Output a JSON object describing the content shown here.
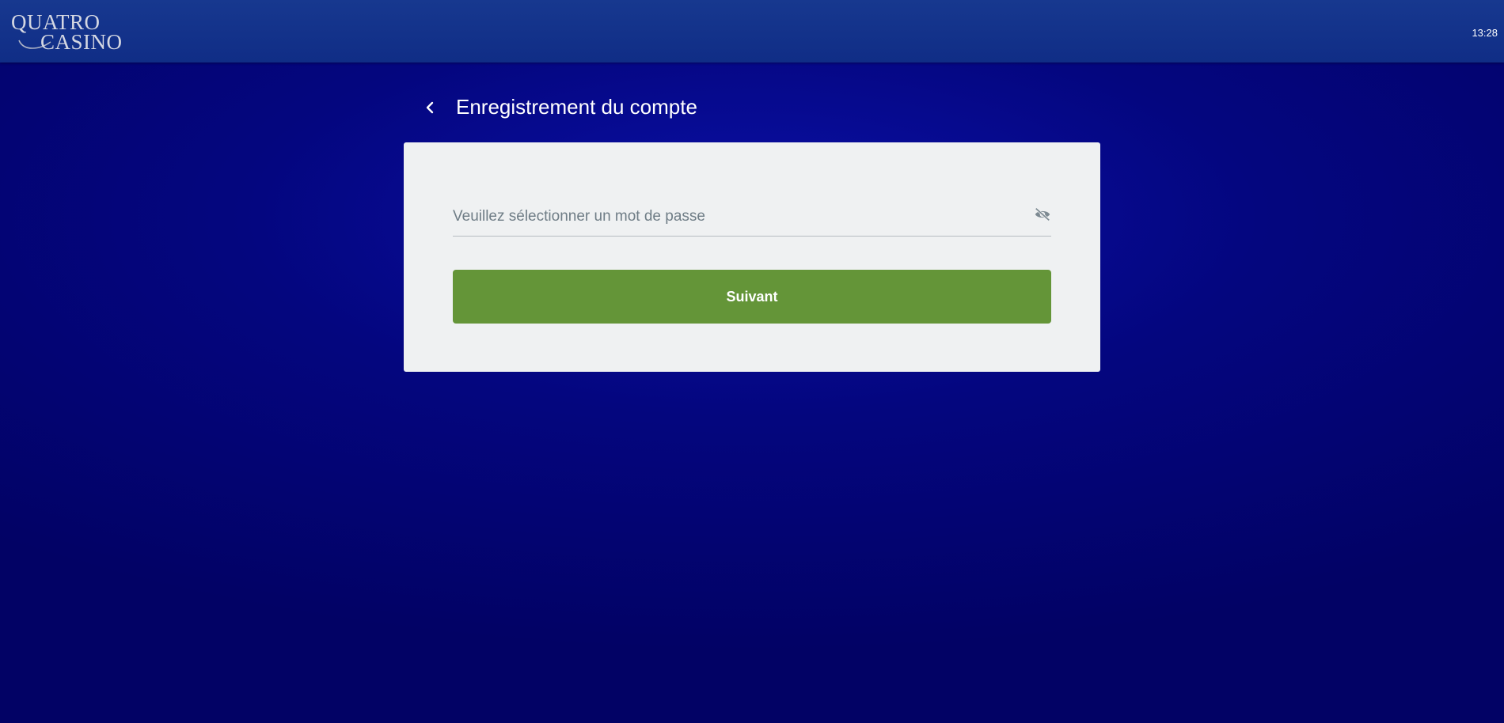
{
  "header": {
    "logo_line1": "QUATRO",
    "logo_line2": "CASINO",
    "clock": "13:28"
  },
  "page": {
    "title": "Enregistrement du compte",
    "back_icon": "chevron-left-icon"
  },
  "form": {
    "password_placeholder": "Veuillez sélectionner un mot de passe",
    "password_value": "",
    "visibility_icon": "eye-off-icon",
    "next_label": "Suivant"
  },
  "colors": {
    "background": "#04067f",
    "header": "#13318a",
    "card": "#eff1f2",
    "button": "#649538"
  }
}
